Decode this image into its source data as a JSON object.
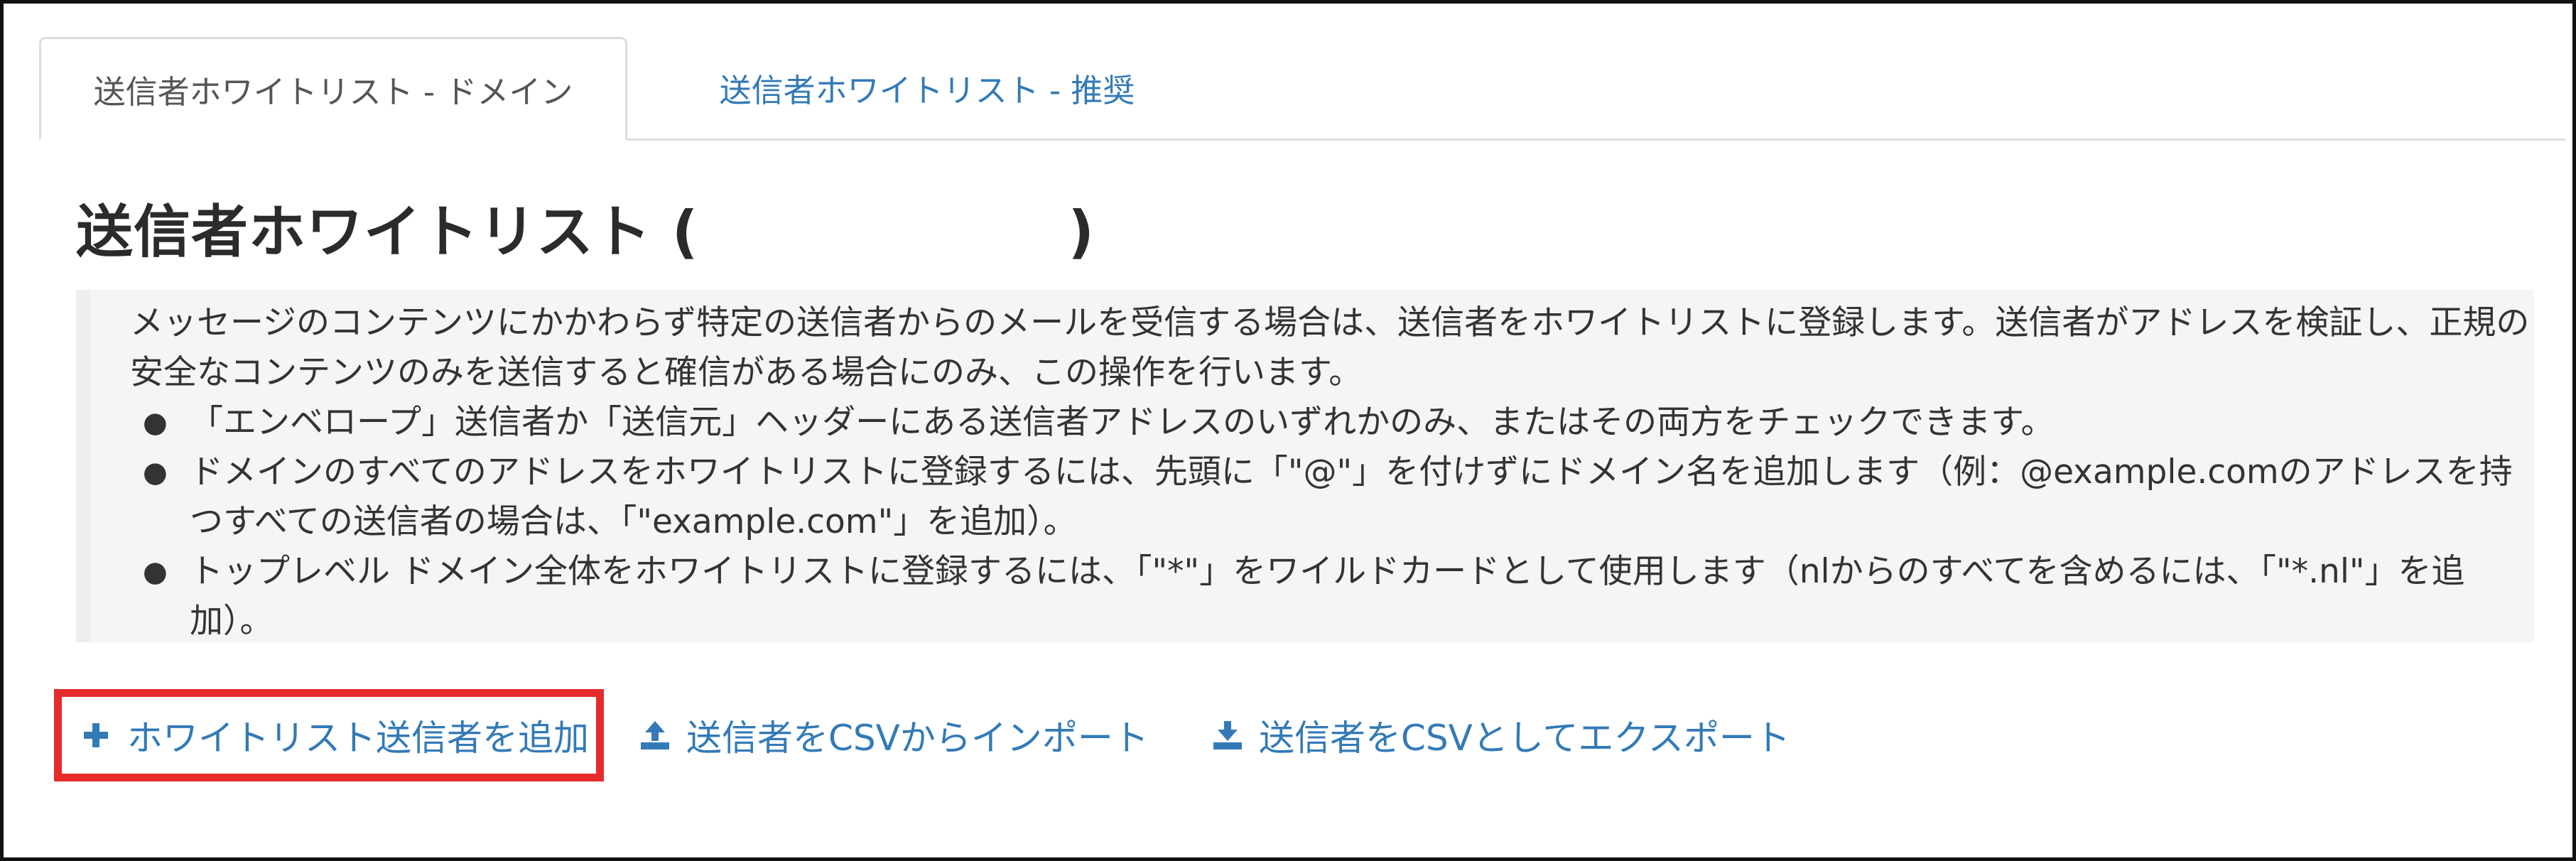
{
  "tabs": [
    {
      "label": "送信者ホワイトリスト - ドメイン",
      "active": true
    },
    {
      "label": "送信者ホワイトリスト - 推奨",
      "active": false
    }
  ],
  "page": {
    "title": "送信者ホワイトリスト (",
    "title_close": ")"
  },
  "description": {
    "paragraph": "メッセージのコンテンツにかかわらず特定の送信者からのメールを受信する場合は、送信者をホワイトリストに登録します。送信者がアドレスを検証し、正規の安全なコンテンツのみを送信すると確信がある場合にのみ、この操作を行います。",
    "bullets": [
      "「エンベロープ」送信者か「送信元」ヘッダーにある送信者アドレスのいずれかのみ、またはその両方をチェックできます。",
      "ドメインのすべてのアドレスをホワイトリストに登録するには、先頭に「\"@\"」を付けずにドメイン名を追加します（例：@example.comのアドレスを持つすべての送信者の場合は、「\"example.com\"」を追加）。",
      "トップレベル ドメイン全体をホワイトリストに登録するには、「\"*\"」をワイルドカードとして使用します（nlからのすべてを含めるには、「\"*.nl\"」を追加）。"
    ]
  },
  "actions": {
    "add_label": "ホワイトリスト送信者を追加",
    "import_label": "送信者をCSVからインポート",
    "export_label": "送信者をCSVとしてエクスポート"
  },
  "icons": {
    "add": "plus-icon",
    "import": "upload-icon",
    "export": "download-icon"
  },
  "colors": {
    "link": "#337ab7",
    "highlight_border": "#e52b2b",
    "blockquote_bg": "#f5f5f5"
  }
}
